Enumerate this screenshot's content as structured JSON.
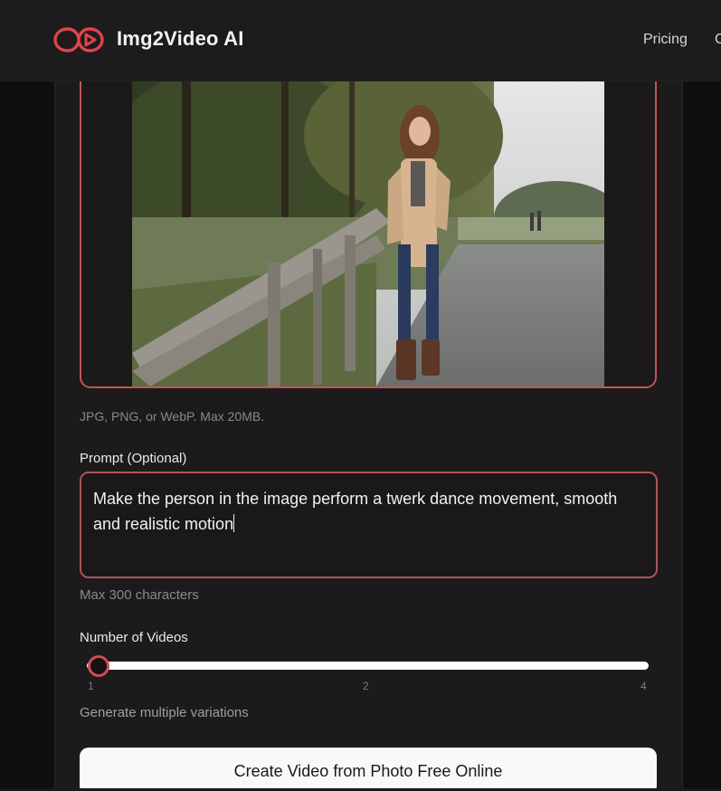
{
  "header": {
    "brand": "Img2Video AI",
    "nav": {
      "pricing": "Pricing",
      "cutoff": "C"
    }
  },
  "upload": {
    "hint": "JPG, PNG, or WebP. Max 20MB."
  },
  "prompt": {
    "label": "Prompt (Optional)",
    "value": "Make the person in the image perform a twerk dance movement, smooth and realistic motion",
    "helper": "Max 300 characters"
  },
  "videos": {
    "label": "Number of Videos",
    "min": 1,
    "max": 4,
    "value": 1,
    "ticks": {
      "t1": "1",
      "t2": "2",
      "t4": "4"
    },
    "helper": "Generate multiple variations"
  },
  "cta": {
    "label": "Create Video from Photo Free Online"
  },
  "colors": {
    "accent": "#c4525d",
    "background": "#1c1a1a",
    "button": "#faf9f9"
  },
  "icons": {
    "logo": "infinity-play-icon"
  }
}
